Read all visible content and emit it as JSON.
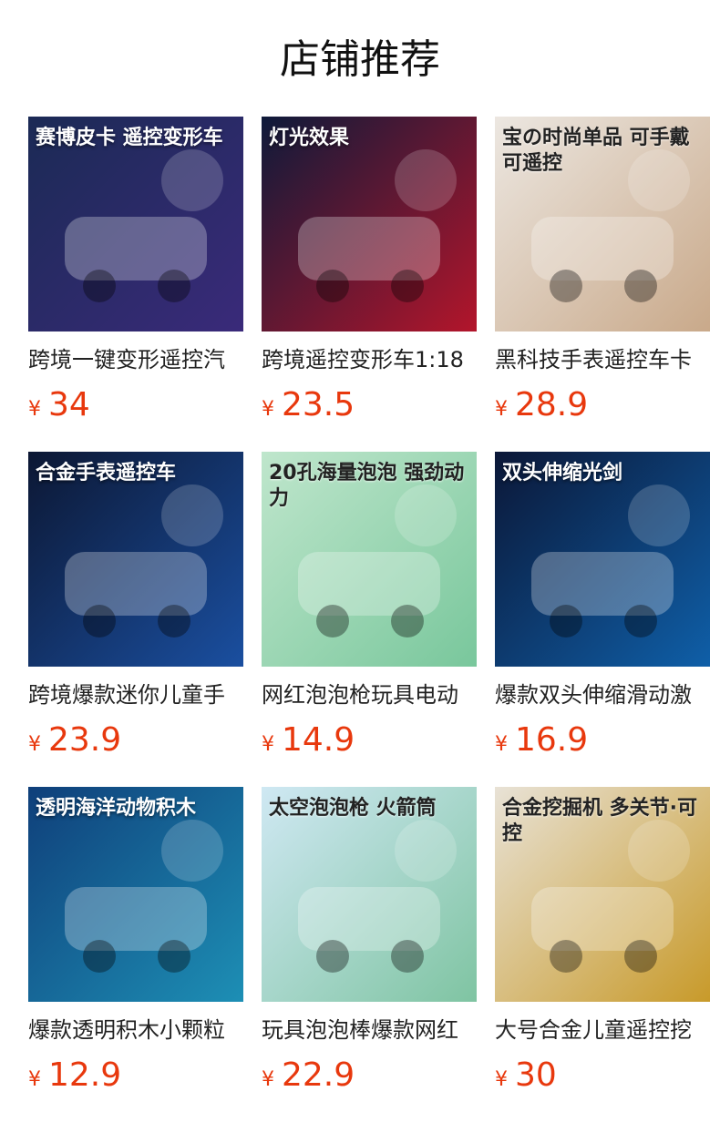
{
  "title": "店铺推荐",
  "currency_symbol": "¥",
  "accent_color": "#e8380d",
  "products": [
    {
      "name": "跨境一键变形遥控汽",
      "price": "34",
      "overlay": "赛博皮卡 遥控变形车",
      "bg": "#1b2a55",
      "bg2": "#3a2a7a",
      "icon": "rc-car-image"
    },
    {
      "name": "跨境遥控变形车1:18",
      "price": "23.5",
      "overlay": "灯光效果",
      "bg": "#0e1a3a",
      "bg2": "#b3152b",
      "icon": "robot-car-image"
    },
    {
      "name": "黑科技手表遥控车卡",
      "price": "28.9",
      "overlay": "宝の时尚单品 可手戴可遥控",
      "bg": "#ece7e1",
      "bg2": "#c9a98a",
      "icon": "watch-toy-image"
    },
    {
      "name": "跨境爆款迷你儿童手",
      "price": "23.9",
      "overlay": "合金手表遥控车",
      "bg": "#0c1733",
      "bg2": "#1a4fa0",
      "icon": "mini-car-image"
    },
    {
      "name": "网红泡泡枪玩具电动",
      "price": "14.9",
      "overlay": "20孔海量泡泡 强劲动力",
      "bg": "#bfe6cc",
      "bg2": "#79c79c",
      "icon": "bubble-gun-image"
    },
    {
      "name": "爆款双头伸缩滑动激",
      "price": "16.9",
      "overlay": "双头伸缩光剑",
      "bg": "#0b1737",
      "bg2": "#0f5fa8",
      "icon": "light-saber-image"
    },
    {
      "name": "爆款透明积木小颗粒",
      "price": "12.9",
      "overlay": "透明海洋动物积木",
      "bg": "#0f3f7a",
      "bg2": "#1d8fb5",
      "icon": "ocean-blocks-image"
    },
    {
      "name": "玩具泡泡棒爆款网红",
      "price": "22.9",
      "overlay": "太空泡泡枪 火箭筒",
      "bg": "#cfe8f3",
      "bg2": "#7fc4a2",
      "icon": "bubble-rocket-image"
    },
    {
      "name": "大号合金儿童遥控挖",
      "price": "30",
      "overlay": "合金挖掘机 多关节·可控",
      "bg": "#e8e2d6",
      "bg2": "#c89a2a",
      "icon": "excavator-image"
    }
  ]
}
